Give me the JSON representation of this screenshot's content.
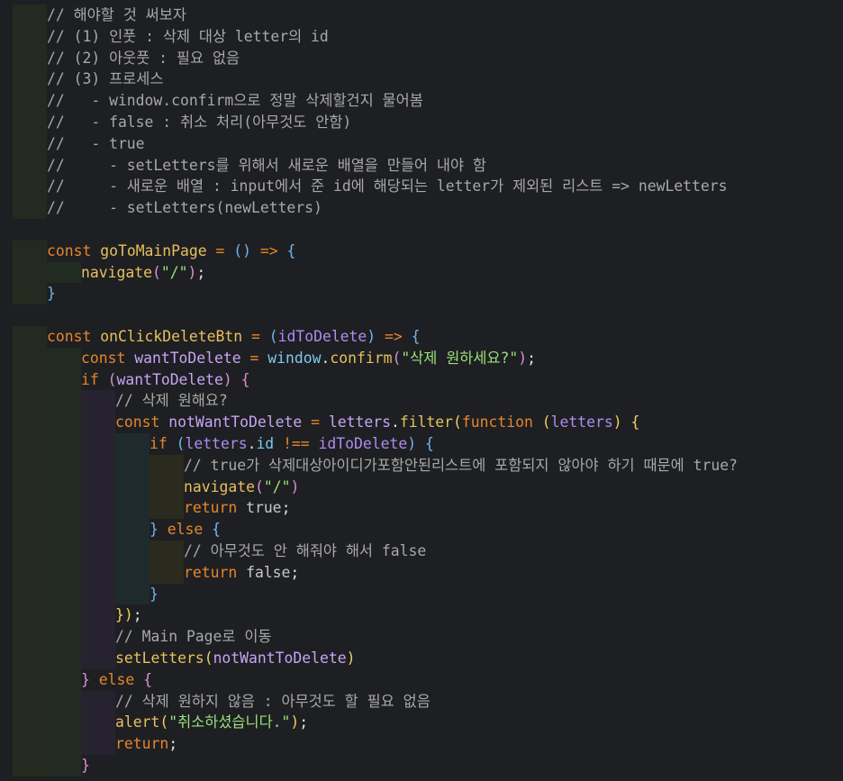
{
  "editor": {
    "lines": [
      {
        "guides": 1,
        "tokens": [
          [
            "cmt",
            "// 해야할 것 써보자"
          ]
        ]
      },
      {
        "guides": 1,
        "tokens": [
          [
            "cmt",
            "// (1) 인풋 : 삭제 대상 letter의 id"
          ]
        ]
      },
      {
        "guides": 1,
        "tokens": [
          [
            "cmt",
            "// (2) 아웃풋 : 필요 없음"
          ]
        ]
      },
      {
        "guides": 1,
        "tokens": [
          [
            "cmt",
            "// (3) 프로세스"
          ]
        ]
      },
      {
        "guides": 1,
        "tokens": [
          [
            "cmt",
            "//   - window.confirm으로 정말 삭제할건지 물어봄"
          ]
        ]
      },
      {
        "guides": 1,
        "tokens": [
          [
            "cmt",
            "//   - false : 취소 처리(아무것도 안함)"
          ]
        ]
      },
      {
        "guides": 1,
        "tokens": [
          [
            "cmt",
            "//   - true"
          ]
        ]
      },
      {
        "guides": 1,
        "tokens": [
          [
            "cmt",
            "//     - setLetters를 위해서 새로운 배열을 만들어 내야 함"
          ]
        ]
      },
      {
        "guides": 1,
        "tokens": [
          [
            "cmt",
            "//     - 새로운 배열 : input에서 준 id에 해당되는 letter가 제외된 리스트 => newLetters"
          ]
        ]
      },
      {
        "guides": 1,
        "tokens": [
          [
            "cmt",
            "//     - setLetters(newLetters)"
          ]
        ]
      },
      {
        "guides": 0,
        "tokens": []
      },
      {
        "guides": 1,
        "tokens": [
          [
            "kw",
            "const "
          ],
          [
            "fn",
            "goToMainPage"
          ],
          [
            "pn",
            " "
          ],
          [
            "op",
            "="
          ],
          [
            "pn",
            " "
          ],
          [
            "p1",
            "()"
          ],
          [
            "pn",
            " "
          ],
          [
            "op",
            "=>"
          ],
          [
            "pn",
            " "
          ],
          [
            "p1",
            "{"
          ]
        ]
      },
      {
        "guides": 2,
        "tokens": [
          [
            "fn",
            "navigate"
          ],
          [
            "p2",
            "("
          ],
          [
            "str",
            "\"/\""
          ],
          [
            "p2",
            ")"
          ],
          [
            "pn",
            ";"
          ]
        ]
      },
      {
        "guides": 1,
        "tokens": [
          [
            "p1",
            "}"
          ]
        ]
      },
      {
        "guides": 0,
        "tokens": []
      },
      {
        "guides": 1,
        "tokens": [
          [
            "kw",
            "const "
          ],
          [
            "fn",
            "onClickDeleteBtn"
          ],
          [
            "pn",
            " "
          ],
          [
            "op",
            "="
          ],
          [
            "pn",
            " "
          ],
          [
            "p1",
            "("
          ],
          [
            "prm",
            "idToDelete"
          ],
          [
            "p1",
            ")"
          ],
          [
            "pn",
            " "
          ],
          [
            "op",
            "=>"
          ],
          [
            "pn",
            " "
          ],
          [
            "p1",
            "{"
          ]
        ]
      },
      {
        "guides": 2,
        "tokens": [
          [
            "kw",
            "const "
          ],
          [
            "var",
            "wantToDelete"
          ],
          [
            "pn",
            " "
          ],
          [
            "op",
            "="
          ],
          [
            "pn",
            " "
          ],
          [
            "prop",
            "window"
          ],
          [
            "pn",
            "."
          ],
          [
            "fn",
            "confirm"
          ],
          [
            "p2",
            "("
          ],
          [
            "str",
            "\"삭제 원하세요?\""
          ],
          [
            "p2",
            ")"
          ],
          [
            "pn",
            ";"
          ]
        ]
      },
      {
        "guides": 2,
        "tokens": [
          [
            "kw",
            "if "
          ],
          [
            "p2",
            "("
          ],
          [
            "var",
            "wantToDelete"
          ],
          [
            "p2",
            ")"
          ],
          [
            "pn",
            " "
          ],
          [
            "p2",
            "{"
          ]
        ]
      },
      {
        "guides": 3,
        "tokens": [
          [
            "cmt",
            "// 삭제 원해요?"
          ]
        ]
      },
      {
        "guides": 3,
        "tokens": [
          [
            "kw",
            "const "
          ],
          [
            "var",
            "notWantToDelete"
          ],
          [
            "pn",
            " "
          ],
          [
            "op",
            "="
          ],
          [
            "pn",
            " "
          ],
          [
            "var",
            "letters"
          ],
          [
            "pn",
            "."
          ],
          [
            "fn",
            "filter"
          ],
          [
            "p3",
            "("
          ],
          [
            "kw",
            "function "
          ],
          [
            "p3",
            "("
          ],
          [
            "prm",
            "letters"
          ],
          [
            "p3",
            ")"
          ],
          [
            "pn",
            " "
          ],
          [
            "p3",
            "{"
          ]
        ]
      },
      {
        "guides": 4,
        "tokens": [
          [
            "kw",
            "if "
          ],
          [
            "p1",
            "("
          ],
          [
            "prm",
            "letters"
          ],
          [
            "pn",
            "."
          ],
          [
            "prop",
            "id"
          ],
          [
            "pn",
            " "
          ],
          [
            "op",
            "!=="
          ],
          [
            "pn",
            " "
          ],
          [
            "prm",
            "idToDelete"
          ],
          [
            "p1",
            ")"
          ],
          [
            "pn",
            " "
          ],
          [
            "p1",
            "{"
          ]
        ]
      },
      {
        "guides": 5,
        "tokens": [
          [
            "cmt",
            "// true가 삭제대상아이디가포함안된리스트에 포함되지 않아야 하기 때문에 true?"
          ]
        ]
      },
      {
        "guides": 5,
        "tokens": [
          [
            "fn",
            "navigate"
          ],
          [
            "p2",
            "("
          ],
          [
            "str",
            "\"/\""
          ],
          [
            "p2",
            ")"
          ]
        ]
      },
      {
        "guides": 5,
        "tokens": [
          [
            "kw",
            "return "
          ],
          [
            "bool",
            "true"
          ],
          [
            "pn",
            ";"
          ]
        ]
      },
      {
        "guides": 4,
        "tokens": [
          [
            "p1",
            "}"
          ],
          [
            "pn",
            " "
          ],
          [
            "kw",
            "else "
          ],
          [
            "p1",
            "{"
          ]
        ]
      },
      {
        "guides": 5,
        "tokens": [
          [
            "cmt",
            "// 아무것도 안 해줘야 해서 false"
          ]
        ]
      },
      {
        "guides": 5,
        "tokens": [
          [
            "kw",
            "return "
          ],
          [
            "bool",
            "false"
          ],
          [
            "pn",
            ";"
          ]
        ]
      },
      {
        "guides": 4,
        "tokens": [
          [
            "p1",
            "}"
          ]
        ]
      },
      {
        "guides": 3,
        "tokens": [
          [
            "p3",
            "})"
          ],
          [
            "pn",
            ";"
          ]
        ]
      },
      {
        "guides": 3,
        "tokens": [
          [
            "cmt",
            "// Main Page로 이동"
          ]
        ]
      },
      {
        "guides": 3,
        "tokens": [
          [
            "fn",
            "setLetters"
          ],
          [
            "p3",
            "("
          ],
          [
            "var",
            "notWantToDelete"
          ],
          [
            "p3",
            ")"
          ]
        ]
      },
      {
        "guides": 2,
        "tokens": [
          [
            "p2",
            "}"
          ],
          [
            "pn",
            " "
          ],
          [
            "kw",
            "else "
          ],
          [
            "p2",
            "{"
          ]
        ]
      },
      {
        "guides": 3,
        "tokens": [
          [
            "cmt",
            "// 삭제 원하지 않음 : 아무것도 할 필요 없음"
          ]
        ]
      },
      {
        "guides": 3,
        "tokens": [
          [
            "fn",
            "alert"
          ],
          [
            "p3",
            "("
          ],
          [
            "str",
            "\"취소하셨습니다.\""
          ],
          [
            "p3",
            ")"
          ],
          [
            "pn",
            ";"
          ]
        ]
      },
      {
        "guides": 3,
        "tokens": [
          [
            "kw",
            "return"
          ],
          [
            "pn",
            ";"
          ]
        ]
      },
      {
        "guides": 2,
        "tokens": [
          [
            "p2",
            "}"
          ]
        ]
      }
    ]
  }
}
